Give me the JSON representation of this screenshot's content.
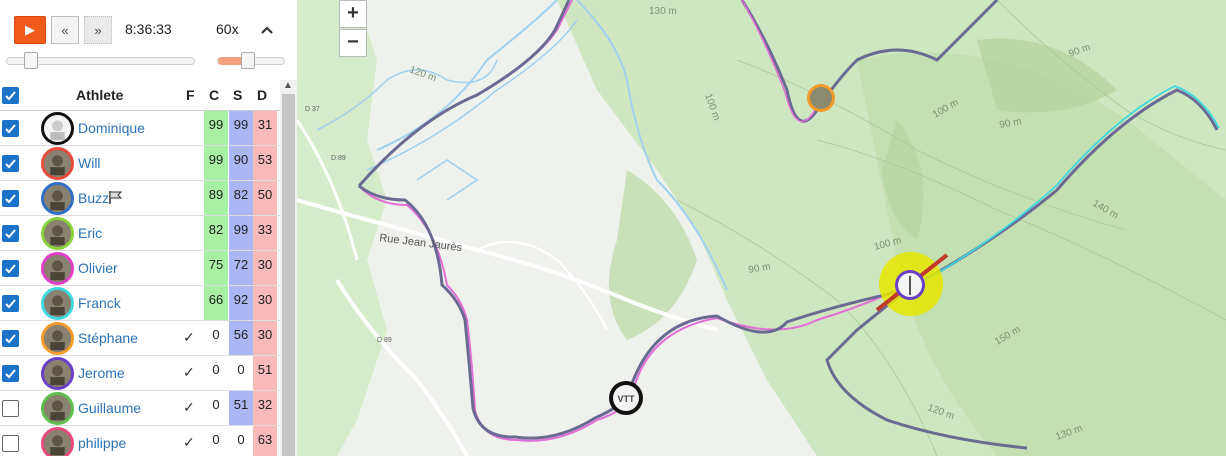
{
  "controls": {
    "play_icon": "▶",
    "step_back_icon": "«",
    "step_forward_icon": "»",
    "clock": "8:36:33",
    "speed": "60x",
    "collapse_icon": "chevron-up-icon",
    "time_position_fraction": 0.1,
    "speed_position_fraction": 0.45
  },
  "table": {
    "headers": {
      "athlete": "Athlete",
      "f": "F",
      "c": "C",
      "s": "S",
      "d": "D"
    },
    "rows": [
      {
        "name": "Dominique",
        "f": "",
        "c": "99",
        "s": "99",
        "d": "31",
        "checked": true,
        "ring": "#111111",
        "flag": false
      },
      {
        "name": "Will",
        "f": "",
        "c": "99",
        "s": "90",
        "d": "53",
        "checked": true,
        "ring": "#e84a3c",
        "flag": false
      },
      {
        "name": "Buzz",
        "f": "",
        "c": "89",
        "s": "82",
        "d": "50",
        "checked": true,
        "ring": "#2f6fc6",
        "flag": true
      },
      {
        "name": "Eric",
        "f": "",
        "c": "82",
        "s": "99",
        "d": "33",
        "checked": true,
        "ring": "#8bd23b",
        "flag": false
      },
      {
        "name": "Olivier",
        "f": "",
        "c": "75",
        "s": "72",
        "d": "30",
        "checked": true,
        "ring": "#e23ec8",
        "flag": false
      },
      {
        "name": "Franck",
        "f": "",
        "c": "66",
        "s": "92",
        "d": "30",
        "checked": true,
        "ring": "#3fd8e0",
        "flag": false
      },
      {
        "name": "Stéphane",
        "f": "✓",
        "c": "0",
        "s": "56",
        "d": "30",
        "checked": true,
        "ring": "#f39a28",
        "flag": false
      },
      {
        "name": "Jerome",
        "f": "✓",
        "c": "0",
        "s": "0",
        "d": "51",
        "checked": true,
        "ring": "#6a3fc8",
        "flag": false
      },
      {
        "name": "Guillaume",
        "f": "✓",
        "c": "0",
        "s": "51",
        "d": "32",
        "checked": false,
        "ring": "#5ec04a",
        "flag": false
      },
      {
        "name": "philippe",
        "f": "✓",
        "c": "0",
        "s": "0",
        "d": "63",
        "checked": false,
        "ring": "#e84a80",
        "flag": false
      }
    ]
  },
  "map": {
    "zoom_in": "+",
    "zoom_out": "−",
    "labels": {
      "street": "Rue Jean Jaurès",
      "d37": "D 37",
      "d89a": "D 89",
      "d89b": "D 89",
      "c130a": "130 m",
      "c120": "120 m",
      "c100a": "100 m",
      "c100b": "100 m",
      "c100c": "100 m",
      "c90a": "90 m",
      "c90b": "90 m",
      "c90c": "90 m",
      "c140": "140 m",
      "c150": "150 m",
      "c120b": "120 m",
      "c130b": "130 m"
    },
    "colors": {
      "accent": "#f05a1a",
      "highlight": "#e6e600"
    }
  }
}
